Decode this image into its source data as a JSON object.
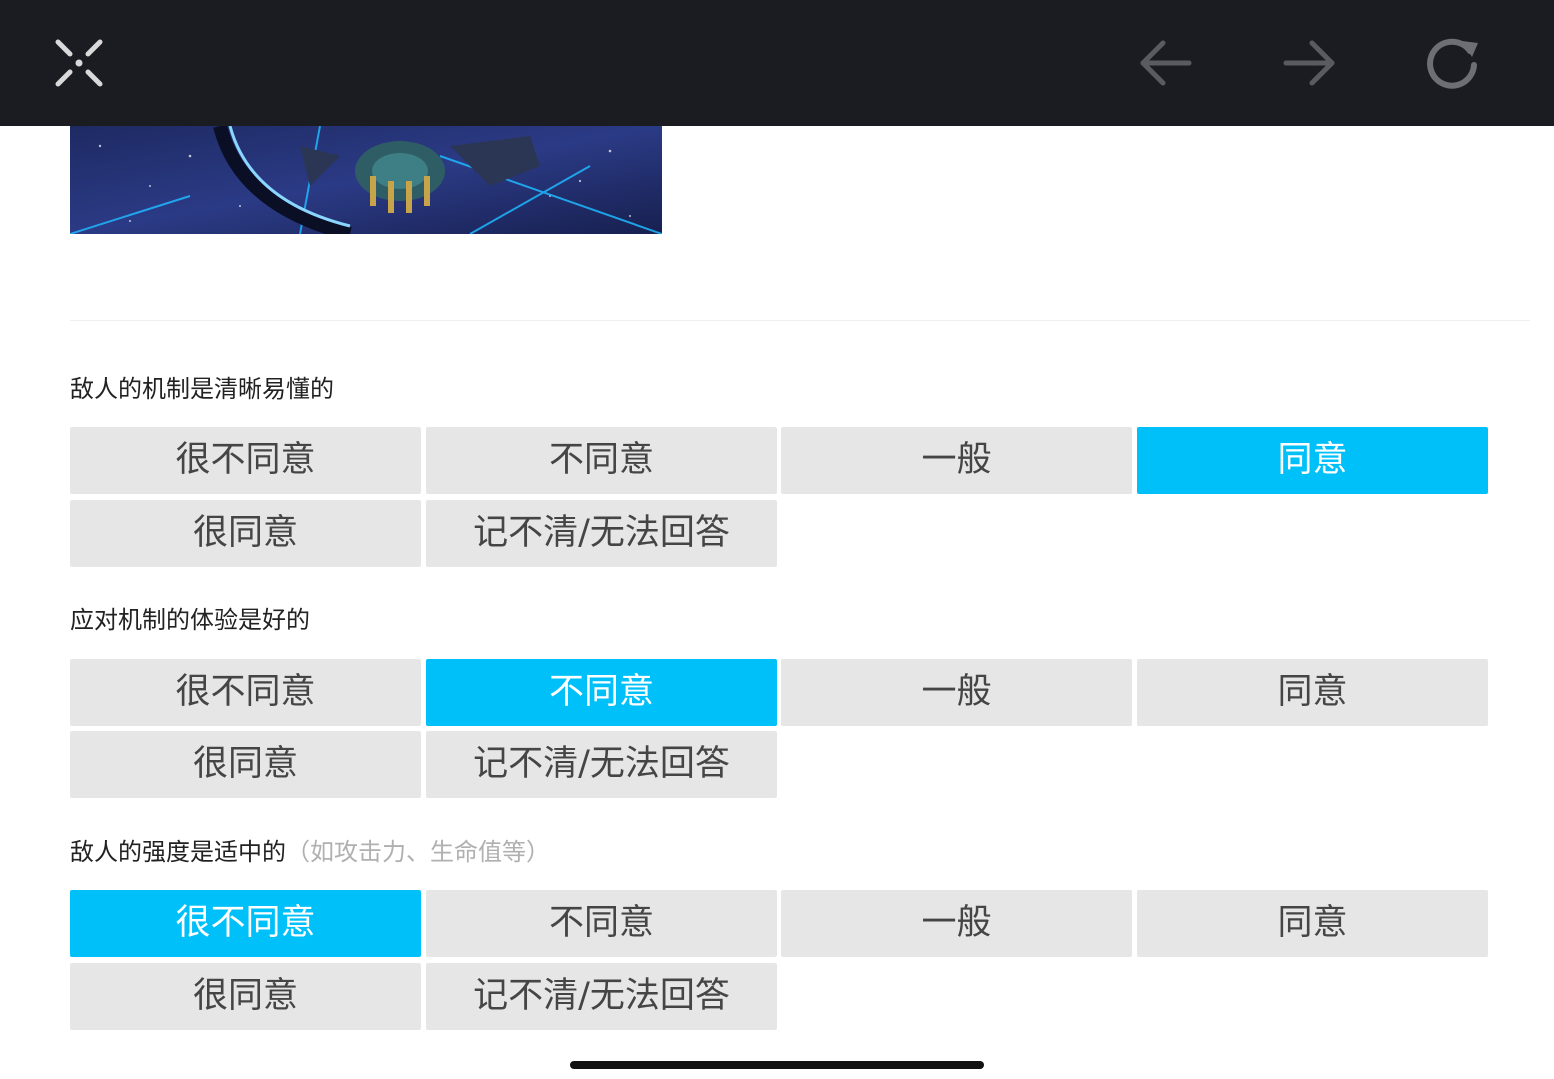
{
  "icons": {
    "close": "collapse-x-icon",
    "back": "arrow-left-icon",
    "forward": "arrow-right-icon",
    "reload": "reload-icon"
  },
  "colors": {
    "topbar": "#1b1c22",
    "selected": "#00c0fa",
    "option_bg": "#e6e6e6"
  },
  "questions": [
    {
      "title": "敌人的机制是清晰易懂的",
      "hint": "",
      "options": [
        "很不同意",
        "不同意",
        "一般",
        "同意",
        "很同意",
        "记不清/无法回答"
      ],
      "selected": 3
    },
    {
      "title": "应对机制的体验是好的",
      "hint": "",
      "options": [
        "很不同意",
        "不同意",
        "一般",
        "同意",
        "很同意",
        "记不清/无法回答"
      ],
      "selected": 1
    },
    {
      "title": "敌人的强度是适中的",
      "hint": "（如攻击力、生命值等）",
      "options": [
        "很不同意",
        "不同意",
        "一般",
        "同意",
        "很同意",
        "记不清/无法回答"
      ],
      "selected": 0
    }
  ]
}
